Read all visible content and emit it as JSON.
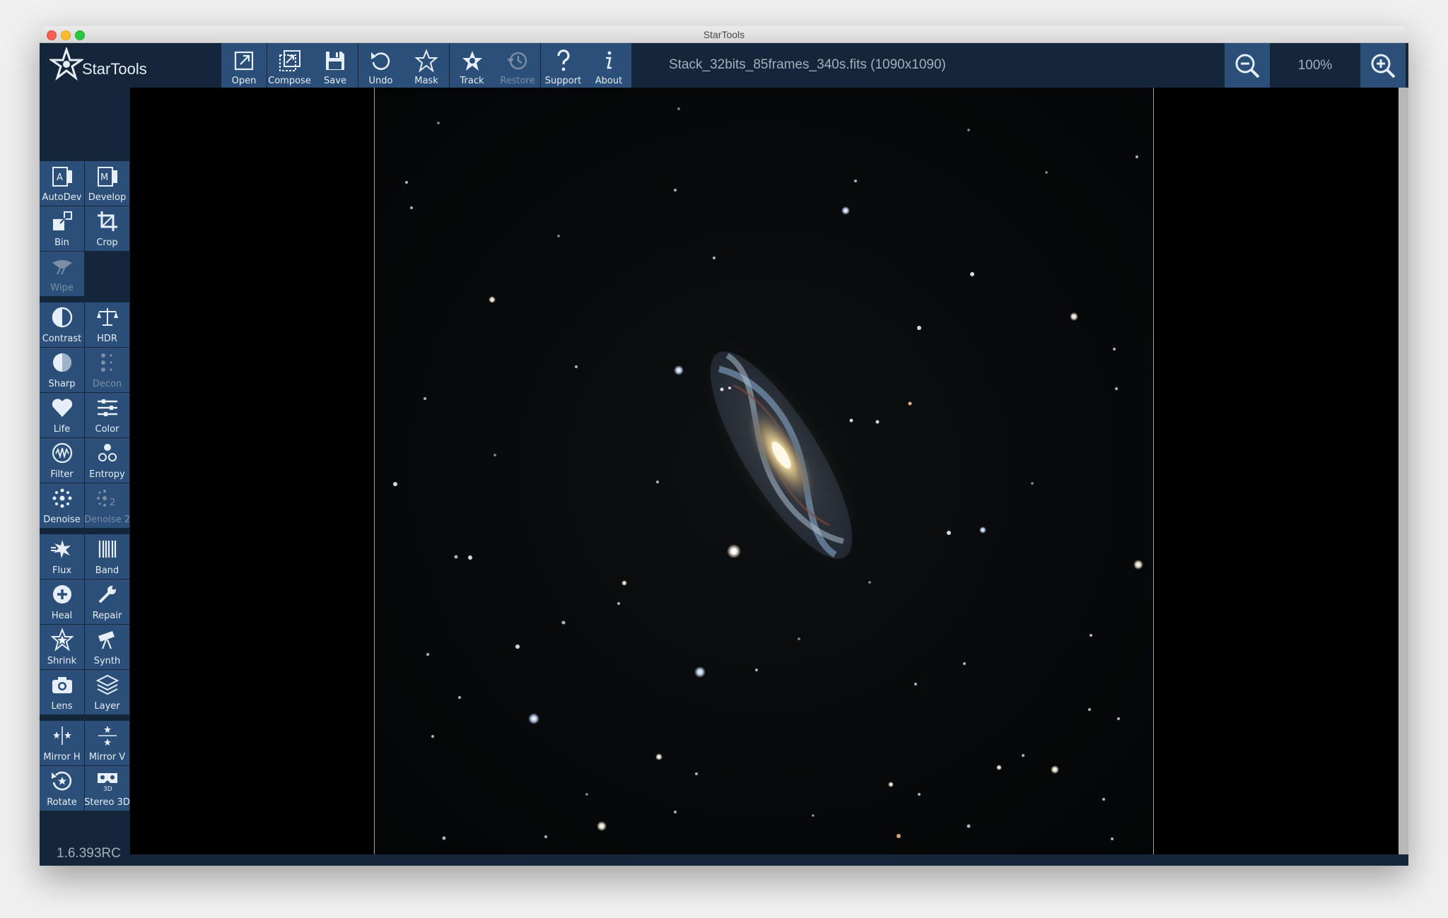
{
  "window": {
    "title": "StarTools"
  },
  "brand": {
    "name": "StarTools"
  },
  "toolbar": [
    {
      "id": "open",
      "label": "Open",
      "icon": "open-external-icon",
      "enabled": true
    },
    {
      "id": "compose",
      "label": "Compose",
      "icon": "compose-icon",
      "enabled": true
    },
    {
      "id": "save",
      "label": "Save",
      "icon": "floppy-disk-icon",
      "enabled": true
    },
    {
      "id": "undo",
      "label": "Undo",
      "icon": "undo-icon",
      "enabled": true
    },
    {
      "id": "mask",
      "label": "Mask",
      "icon": "star-outline-icon",
      "enabled": true
    },
    {
      "id": "track",
      "label": "Track",
      "icon": "star-track-icon",
      "enabled": true
    },
    {
      "id": "restore",
      "label": "Restore",
      "icon": "restore-history-icon",
      "enabled": false
    },
    {
      "id": "support",
      "label": "Support",
      "icon": "question-mark-icon",
      "enabled": true
    },
    {
      "id": "about",
      "label": "About",
      "icon": "info-icon",
      "enabled": true
    }
  ],
  "file": {
    "name": "Stack_32bits_85frames_340s.fits (1090x1090)"
  },
  "zoom": {
    "level": "100%"
  },
  "modules": [
    {
      "id": "autodev",
      "label": "AutoDev",
      "icon": "autodev-icon",
      "enabled": true
    },
    {
      "id": "develop",
      "label": "Develop",
      "icon": "develop-icon",
      "enabled": true
    },
    {
      "id": "bin",
      "label": "Bin",
      "icon": "bin-icon",
      "enabled": true
    },
    {
      "id": "crop",
      "label": "Crop",
      "icon": "crop-icon",
      "enabled": true
    },
    {
      "id": "wipe",
      "label": "Wipe",
      "icon": "wipe-icon",
      "enabled": false
    },
    {
      "id": "contrast",
      "label": "Contrast",
      "icon": "contrast-icon",
      "enabled": true
    },
    {
      "id": "hdr",
      "label": "HDR",
      "icon": "balance-scale-icon",
      "enabled": true
    },
    {
      "id": "sharp",
      "label": "Sharp",
      "icon": "sharp-icon",
      "enabled": true
    },
    {
      "id": "decon",
      "label": "Decon",
      "icon": "decon-dots-icon",
      "enabled": false
    },
    {
      "id": "life",
      "label": "Life",
      "icon": "heart-icon",
      "enabled": true
    },
    {
      "id": "color",
      "label": "Color",
      "icon": "sliders-icon",
      "enabled": true
    },
    {
      "id": "filter",
      "label": "Filter",
      "icon": "filter-wave-icon",
      "enabled": true
    },
    {
      "id": "entropy",
      "label": "Entropy",
      "icon": "entropy-icon",
      "enabled": true
    },
    {
      "id": "denoise",
      "label": "Denoise",
      "icon": "denoise-dots-icon",
      "enabled": true
    },
    {
      "id": "denoise2",
      "label": "Denoise 2",
      "icon": "denoise-2-icon",
      "enabled": false
    },
    {
      "id": "flux",
      "label": "Flux",
      "icon": "flux-icon",
      "enabled": true
    },
    {
      "id": "band",
      "label": "Band",
      "icon": "band-icon",
      "enabled": true
    },
    {
      "id": "heal",
      "label": "Heal",
      "icon": "heal-plus-icon",
      "enabled": true
    },
    {
      "id": "repair",
      "label": "Repair",
      "icon": "wrench-icon",
      "enabled": true
    },
    {
      "id": "shrink",
      "label": "Shrink",
      "icon": "shrink-star-icon",
      "enabled": true
    },
    {
      "id": "synth",
      "label": "Synth",
      "icon": "telescope-icon",
      "enabled": true
    },
    {
      "id": "lens",
      "label": "Lens",
      "icon": "camera-icon",
      "enabled": true
    },
    {
      "id": "layer",
      "label": "Layer",
      "icon": "layers-icon",
      "enabled": true
    },
    {
      "id": "mirrorh",
      "label": "Mirror H",
      "icon": "mirror-horizontal-icon",
      "enabled": true
    },
    {
      "id": "mirrorv",
      "label": "Mirror V",
      "icon": "mirror-vertical-icon",
      "enabled": true
    },
    {
      "id": "rotate",
      "label": "Rotate",
      "icon": "rotate-icon",
      "enabled": true
    },
    {
      "id": "stereo3d",
      "label": "Stereo 3D",
      "icon": "vr-headset-icon",
      "enabled": true
    }
  ],
  "version": "1.6.393RC",
  "colors": {
    "panel": "#15263a",
    "button": "#2b4f78",
    "canvas": "#000000"
  }
}
